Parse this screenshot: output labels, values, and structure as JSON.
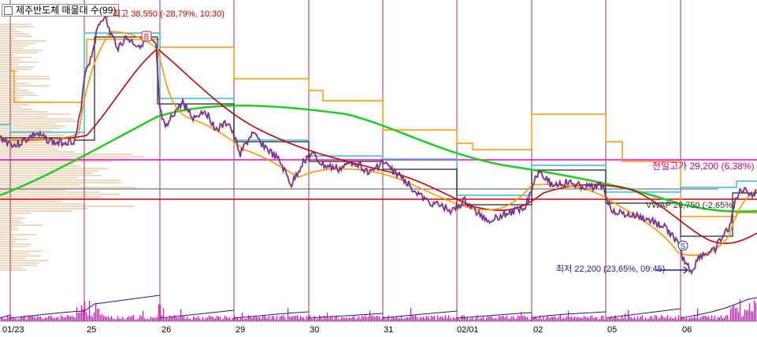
{
  "window": {
    "title": "제주반도체 매물대 수(99)"
  },
  "annotations": {
    "high": "최고 38,550 (-28,79%, 10:30)",
    "low": "최저 22,200 (23,65%, 09:45)",
    "prev_high": "전일고가 29,200 (6,38%)",
    "vwap": "VWAP 26,750 (-2,65%)",
    "buy_marker": "B",
    "sell_marker": "S"
  },
  "x_axis": {
    "date_labels": [
      "01/23",
      "25",
      "26",
      "29",
      "30",
      "31",
      "02/01",
      "02",
      "05",
      "06"
    ]
  },
  "colors": {
    "price": "#3030c0",
    "price_fill": "#e03030",
    "ma_fast": "#ff9900",
    "ma_mid": "#cc0000",
    "ma_slow": "#22cc22",
    "channel_high": "#ff9900",
    "channel_cyan": "#33bbee",
    "box_dark": "#202020",
    "prev_high_line": "#ff00cc",
    "ref_red_line": "#dd0000",
    "ref_grey_line": "#555555",
    "session_divider": "#b03050",
    "volume_bar": "#ff00aa",
    "cum_volume": "#1a1aa0",
    "volume_profile": "#f2d8c0"
  },
  "chart_data": {
    "type": "line",
    "title": "제주반도체 매물대 수(99)",
    "x": [
      "01/23",
      "25",
      "26",
      "29",
      "30",
      "31",
      "02/01",
      "02",
      "05",
      "06"
    ],
    "series": [
      {
        "values": [
          28500,
          37800,
          30500,
          28400,
          27700,
          26900,
          26100,
          28000,
          24500,
          27500
        ]
      }
    ],
    "reference_lines": [
      {
        "label": "전일고가",
        "value": 29200
      },
      {
        "label": "VWAP",
        "value": 26750
      }
    ],
    "extremes": [
      {
        "label": "최고",
        "value": 38550
      },
      {
        "label": "최저",
        "value": 22200
      }
    ]
  }
}
